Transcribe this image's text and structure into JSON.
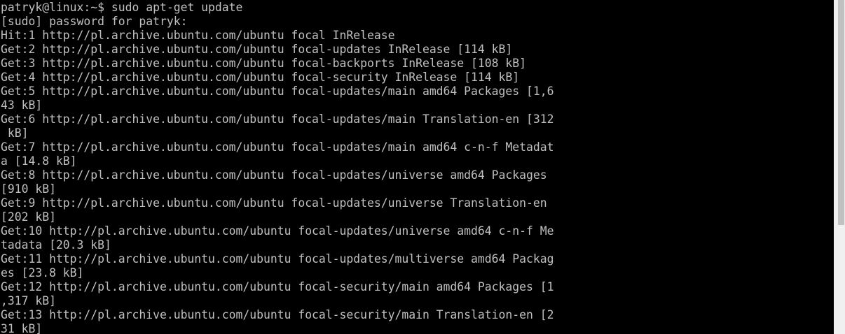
{
  "terminal": {
    "lines": [
      "patryk@linux:~$ sudo apt-get update",
      "[sudo] password for patryk:",
      "Hit:1 http://pl.archive.ubuntu.com/ubuntu focal InRelease",
      "Get:2 http://pl.archive.ubuntu.com/ubuntu focal-updates InRelease [114 kB]",
      "Get:3 http://pl.archive.ubuntu.com/ubuntu focal-backports InRelease [108 kB]",
      "Get:4 http://pl.archive.ubuntu.com/ubuntu focal-security InRelease [114 kB]",
      "Get:5 http://pl.archive.ubuntu.com/ubuntu focal-updates/main amd64 Packages [1,6",
      "43 kB]",
      "Get:6 http://pl.archive.ubuntu.com/ubuntu focal-updates/main Translation-en [312",
      " kB]",
      "Get:7 http://pl.archive.ubuntu.com/ubuntu focal-updates/main amd64 c-n-f Metadat",
      "a [14.8 kB]",
      "Get:8 http://pl.archive.ubuntu.com/ubuntu focal-updates/universe amd64 Packages",
      "[910 kB]",
      "Get:9 http://pl.archive.ubuntu.com/ubuntu focal-updates/universe Translation-en",
      "[202 kB]",
      "Get:10 http://pl.archive.ubuntu.com/ubuntu focal-updates/universe amd64 c-n-f Me",
      "tadata [20.3 kB]",
      "Get:11 http://pl.archive.ubuntu.com/ubuntu focal-updates/multiverse amd64 Packag",
      "es [23.8 kB]",
      "Get:12 http://pl.archive.ubuntu.com/ubuntu focal-security/main amd64 Packages [1",
      ",317 kB]",
      "Get:13 http://pl.archive.ubuntu.com/ubuntu focal-security/main Translation-en [2",
      "31 kB]"
    ],
    "colors": {
      "background": "#000000",
      "foreground": "#c0c0c0",
      "scrollbar_track": "#f0f0f0",
      "scrollbar_thumb": "#c1c1c1"
    }
  }
}
